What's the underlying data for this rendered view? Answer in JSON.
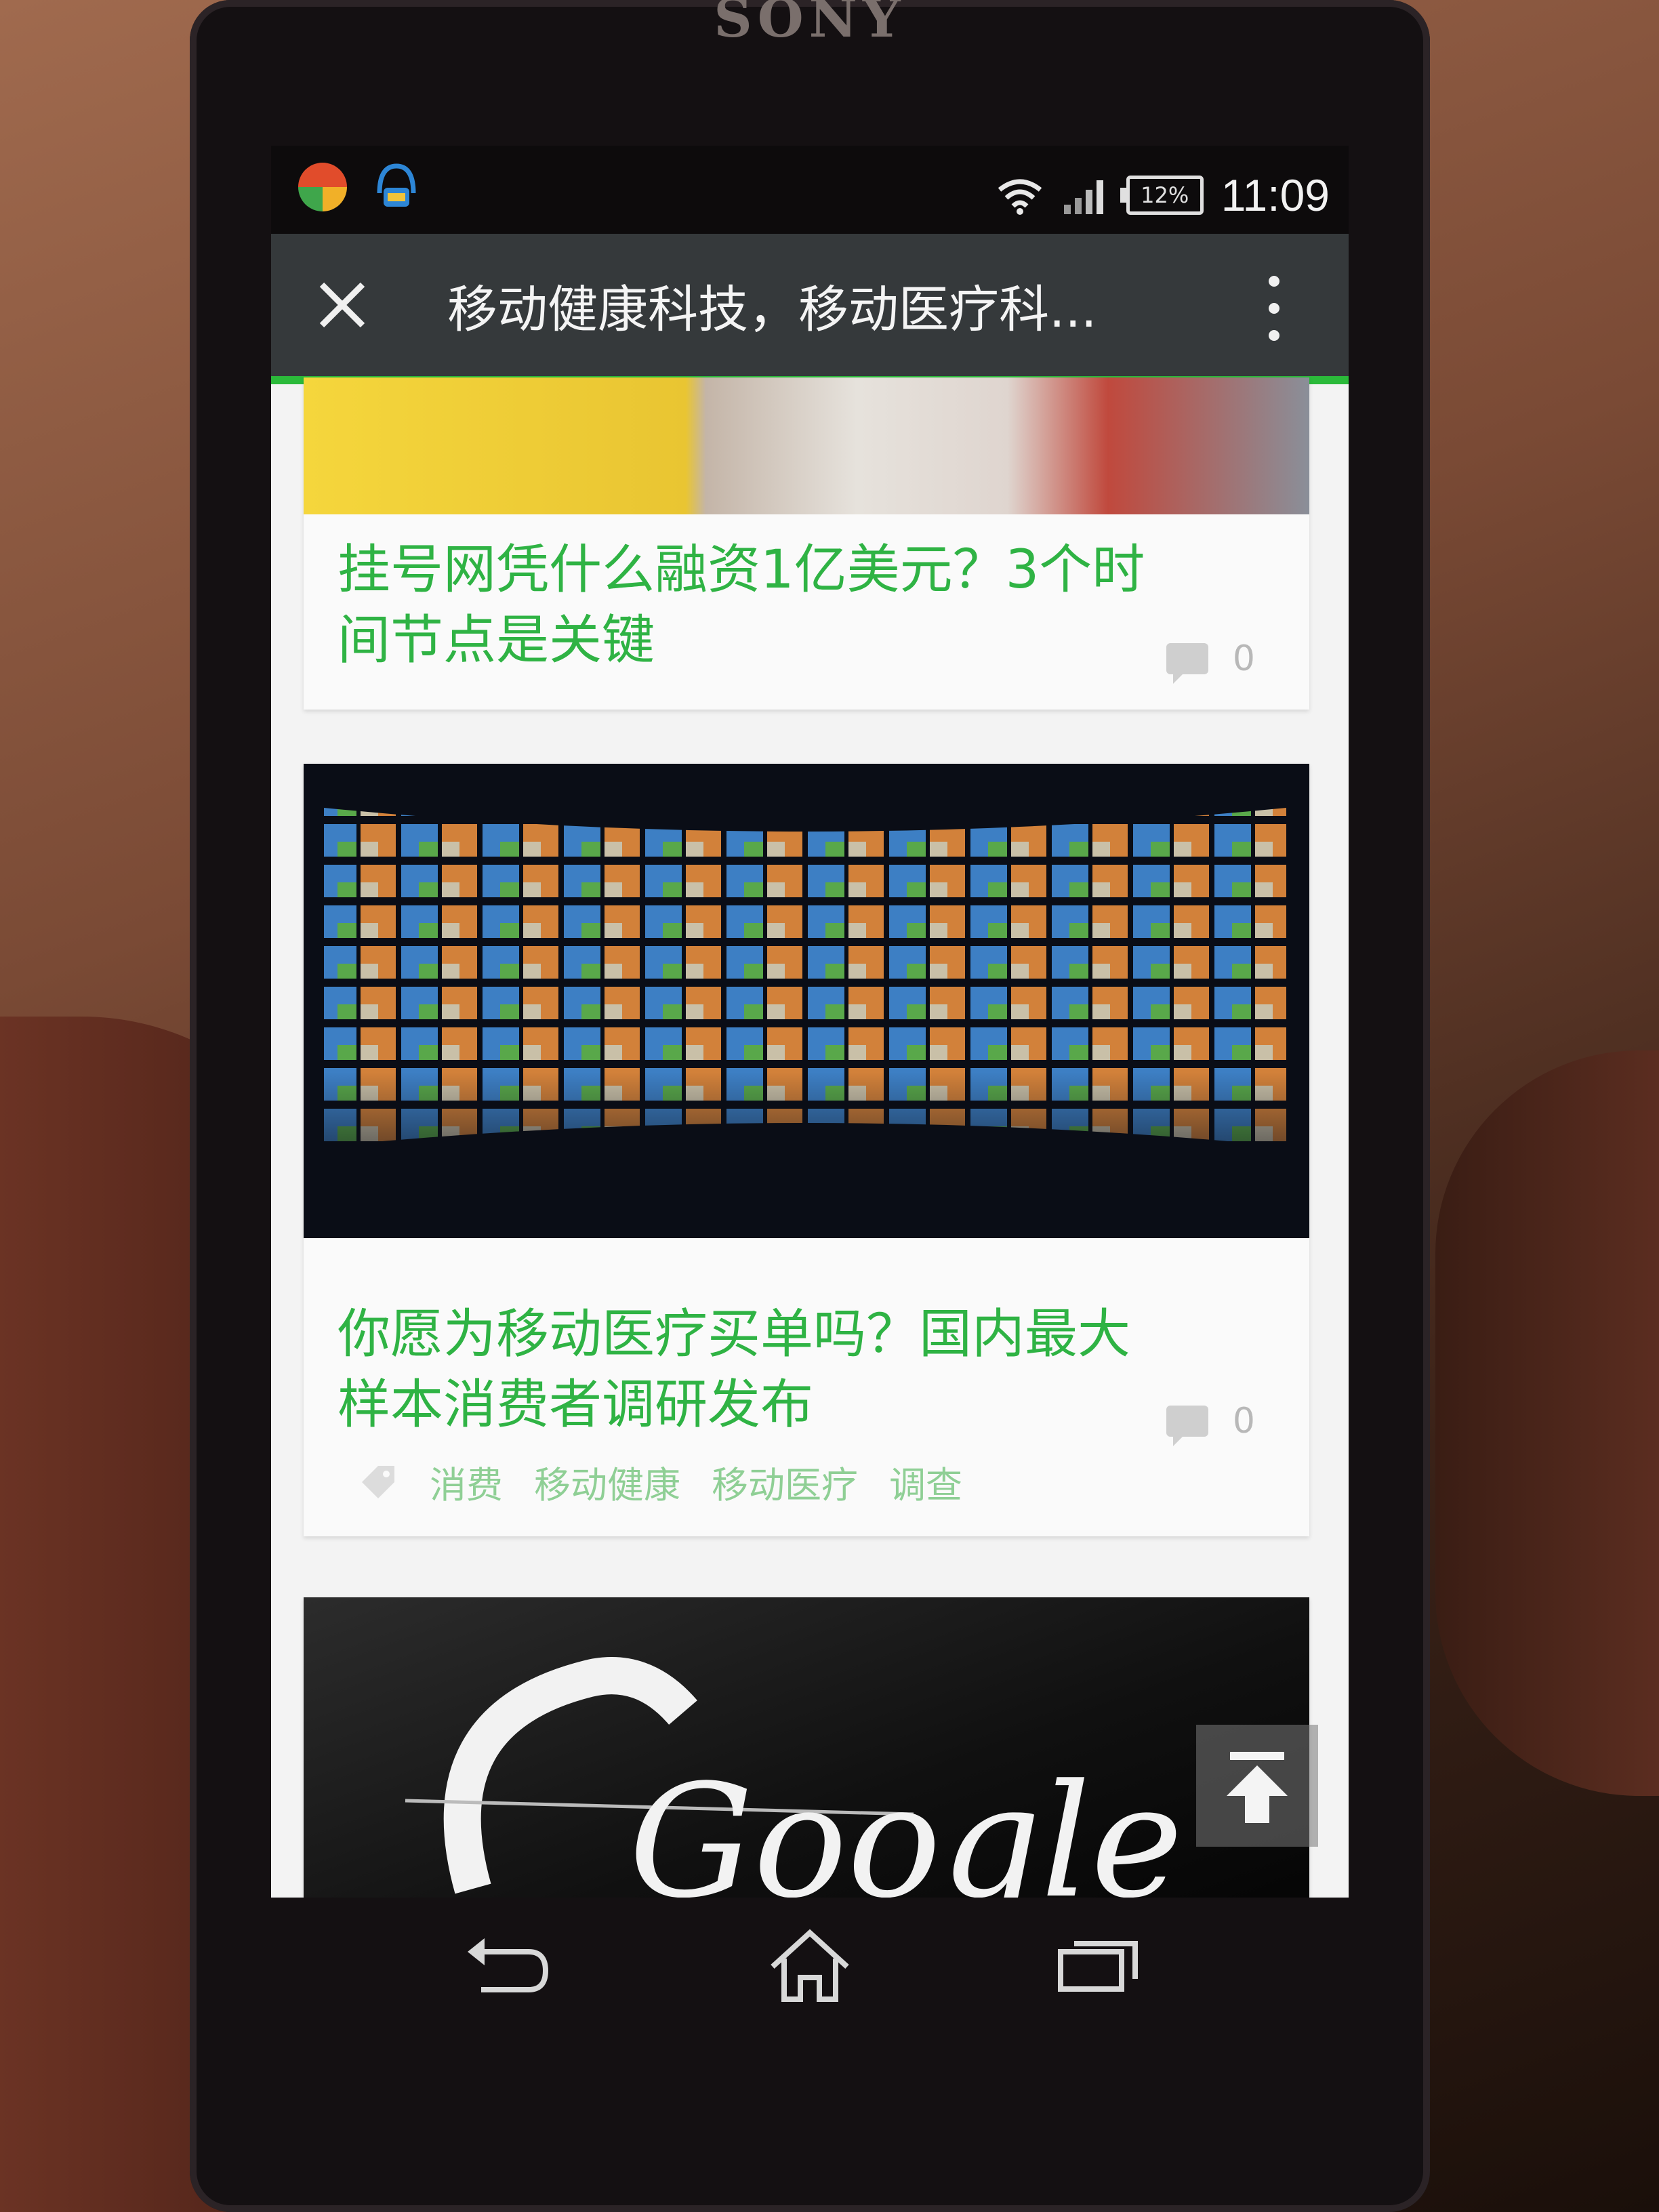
{
  "phone": {
    "brand": "SONY"
  },
  "status_bar": {
    "battery": "12%",
    "time": "11:09",
    "icons": [
      "app-icon",
      "notification-app-icon",
      "wifi-icon",
      "signal-icon",
      "battery-icon"
    ]
  },
  "title_bar": {
    "title": "移动健康科技，移动医疗科...",
    "close_icon": "close-icon",
    "menu_icon": "more-vertical-icon"
  },
  "articles": [
    {
      "title": "挂号网凭什么融资1亿美元？3个时间节点是关键",
      "comment_count": "0"
    },
    {
      "title": "你愿为移动医疗买单吗？国内最大样本消费者调研发布",
      "comment_count": "0",
      "tags": [
        "消费",
        "移动健康",
        "移动医疗",
        "调查"
      ]
    },
    {
      "image_text": "Google"
    }
  ],
  "colors": {
    "accent": "#2fb344",
    "title_bar": "#35393b",
    "progress": "#2bba3a"
  },
  "nav": [
    "back-icon",
    "home-icon",
    "recent-apps-icon"
  ]
}
